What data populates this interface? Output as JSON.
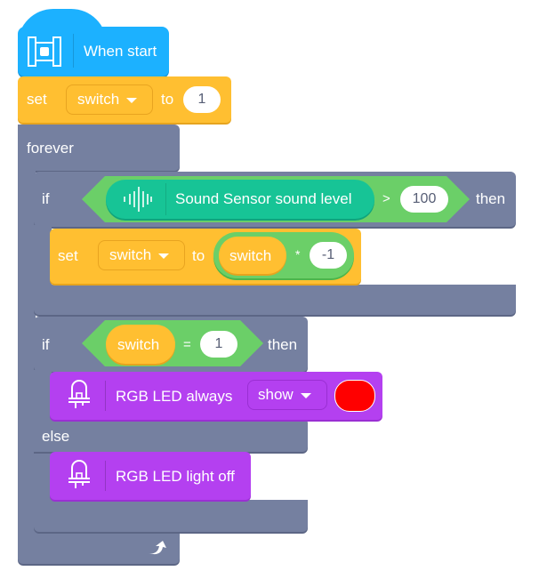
{
  "blocks": {
    "hat": {
      "label": "When start",
      "icon": "start-icon"
    },
    "set_initial": {
      "keyword": "set",
      "variable": "switch",
      "to": "to",
      "value": "1"
    },
    "forever": {
      "label": "forever",
      "icon": "loop-arrow-icon"
    },
    "if_sound": {
      "keyword": "if",
      "sensor_label": "Sound Sensor sound level",
      "sensor_icon": "sound-wave-icon",
      "operator": ">",
      "value": "100",
      "then": "then"
    },
    "set_toggle": {
      "keyword": "set",
      "variable": "switch",
      "to": "to",
      "operand_var": "switch",
      "operator": "*",
      "operand_value": "-1"
    },
    "if_else": {
      "keyword": "if",
      "variable": "switch",
      "operator": "=",
      "value": "1",
      "then": "then",
      "else": "else"
    },
    "led_show": {
      "label": "RGB LED always",
      "mode": "show",
      "color": "#ff0000",
      "icon": "led-icon"
    },
    "led_off": {
      "label": "RGB LED light off",
      "icon": "led-icon"
    }
  },
  "colors": {
    "event": "#1cb1ff",
    "variable": "#ffbf31",
    "control": "#7580a0",
    "operator": "#6bcf68",
    "sensor": "#17c496",
    "led": "#b440f0"
  }
}
